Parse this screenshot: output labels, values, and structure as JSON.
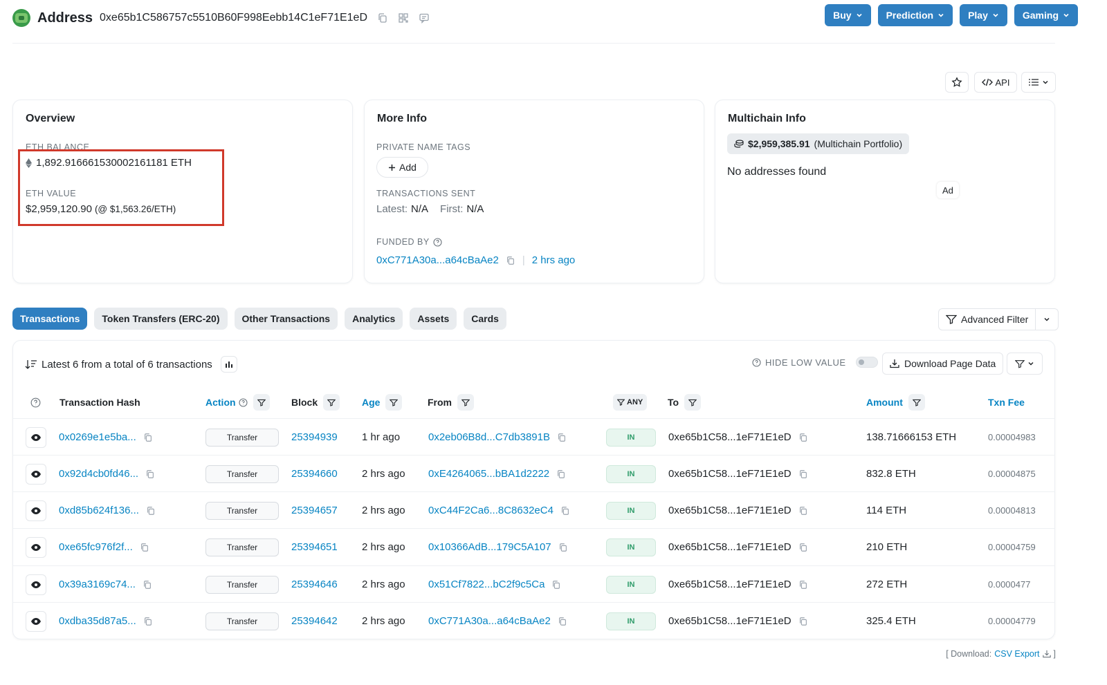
{
  "header": {
    "title": "Address",
    "address": "0xe65b1C586757c5510B60F998Eebb14C1eF71E1eD",
    "buttons": [
      "Buy",
      "Prediction",
      "Play",
      "Gaming"
    ]
  },
  "toolbar": {
    "api_label": "API"
  },
  "overview": {
    "title": "Overview",
    "eth_balance_label": "ETH BALANCE",
    "eth_balance": "1,892.916661530002161181 ETH",
    "eth_value_label": "ETH VALUE",
    "eth_value": "$2,959,120.90",
    "eth_price": "(@ $1,563.26/ETH)"
  },
  "more_info": {
    "title": "More Info",
    "private_tags_label": "PRIVATE NAME TAGS",
    "add_label": "Add",
    "tx_sent_label": "TRANSACTIONS SENT",
    "latest_label": "Latest:",
    "latest_value": "N/A",
    "first_label": "First:",
    "first_value": "N/A",
    "funded_by_label": "FUNDED BY",
    "funded_by_addr": "0xC771A30a...a64cBaAe2",
    "funded_by_age": "2 hrs ago"
  },
  "multichain": {
    "title": "Multichain Info",
    "portfolio_value": "$2,959,385.91",
    "portfolio_label": "(Multichain Portfolio)",
    "no_addresses": "No addresses found",
    "ad": "Ad"
  },
  "tabs": [
    "Transactions",
    "Token Transfers (ERC-20)",
    "Other Transactions",
    "Analytics",
    "Assets",
    "Cards"
  ],
  "advanced_filter": "Advanced Filter",
  "summary": "Latest 6 from a total of 6 transactions",
  "hide_low_value": "HIDE LOW VALUE",
  "download_page_data": "Download Page Data",
  "columns": {
    "hash": "Transaction Hash",
    "action": "Action",
    "block": "Block",
    "age": "Age",
    "from": "From",
    "any": "ANY",
    "to": "To",
    "amount": "Amount",
    "fee": "Txn Fee"
  },
  "rows": [
    {
      "hash": "0x0269e1e5ba...",
      "action": "Transfer",
      "block": "25394939",
      "age": "1 hr ago",
      "from": "0x2eb06B8d...C7db3891B",
      "dir": "IN",
      "to": "0xe65b1C58...1eF71E1eD",
      "amount": "138.71666153 ETH",
      "fee": "0.00004983"
    },
    {
      "hash": "0x92d4cb0fd46...",
      "action": "Transfer",
      "block": "25394660",
      "age": "2 hrs ago",
      "from": "0xE4264065...bBA1d2222",
      "dir": "IN",
      "to": "0xe65b1C58...1eF71E1eD",
      "amount": "832.8 ETH",
      "fee": "0.00004875"
    },
    {
      "hash": "0xd85b624f136...",
      "action": "Transfer",
      "block": "25394657",
      "age": "2 hrs ago",
      "from": "0xC44F2Ca6...8C8632eC4",
      "dir": "IN",
      "to": "0xe65b1C58...1eF71E1eD",
      "amount": "114 ETH",
      "fee": "0.00004813"
    },
    {
      "hash": "0xe65fc976f2f...",
      "action": "Transfer",
      "block": "25394651",
      "age": "2 hrs ago",
      "from": "0x10366AdB...179C5A107",
      "dir": "IN",
      "to": "0xe65b1C58...1eF71E1eD",
      "amount": "210 ETH",
      "fee": "0.00004759"
    },
    {
      "hash": "0x39a3169c74...",
      "action": "Transfer",
      "block": "25394646",
      "age": "2 hrs ago",
      "from": "0x51Cf7822...bC2f9c5Ca",
      "dir": "IN",
      "to": "0xe65b1C58...1eF71E1eD",
      "amount": "272 ETH",
      "fee": "0.0000477"
    },
    {
      "hash": "0xdba35d87a5...",
      "action": "Transfer",
      "block": "25394642",
      "age": "2 hrs ago",
      "from": "0xC771A30a...a64cBaAe2",
      "dir": "IN",
      "to": "0xe65b1C58...1eF71E1eD",
      "amount": "325.4 ETH",
      "fee": "0.00004779"
    }
  ],
  "footer": {
    "download_prefix": "[ Download:",
    "csv_export": "CSV Export",
    "suffix": "]"
  },
  "colors": {
    "primary": "#2f7fc1",
    "link": "#0784c3",
    "highlight_border": "#d0392b",
    "in_badge": "#2f9c6a"
  }
}
